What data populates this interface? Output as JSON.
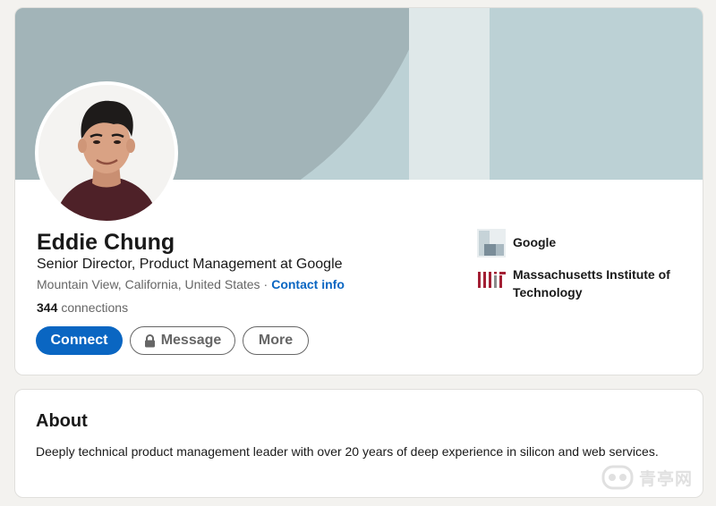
{
  "profile": {
    "name": "Eddie Chung",
    "headline": "Senior Director, Product Management at Google",
    "location": "Mountain View, California, United States",
    "separator": "·",
    "contact_info_label": "Contact info",
    "connections_count": "344",
    "connections_label": "connections",
    "avatar_icon": "profile-photo",
    "buttons": {
      "connect": "Connect",
      "message": "Message",
      "more": "More"
    }
  },
  "experience_summary": {
    "company": "Google",
    "company_icon": "company-logo-placeholder",
    "school": "Massachusetts Institute of Technology",
    "school_icon": "mit-logo"
  },
  "about": {
    "title": "About",
    "text": "Deeply technical product management leader with over 20 years of deep experience in silicon and web services."
  },
  "watermark": {
    "text": "青亭网"
  },
  "colors": {
    "accent": "#0a66c2",
    "banner": "#bcd1d5",
    "banner_arc": "#a2b4b8",
    "page_bg": "#f3f2ef"
  }
}
